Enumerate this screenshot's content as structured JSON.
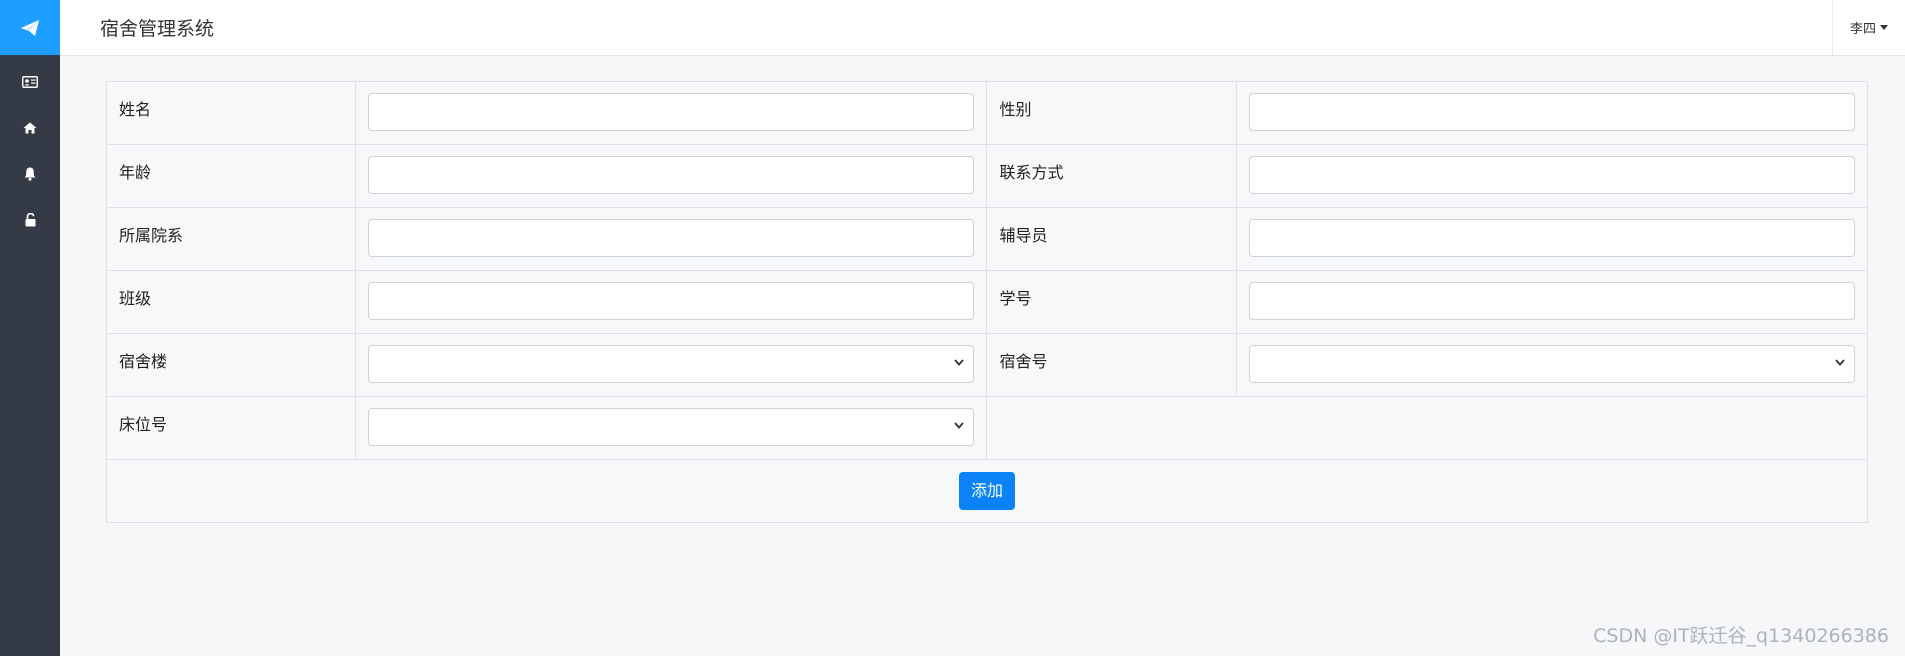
{
  "app": {
    "title": "宿舍管理系统",
    "user_name": "李四"
  },
  "sidebar": {
    "logo_icon": "paper-plane-icon",
    "items": [
      {
        "icon": "id-card-icon"
      },
      {
        "icon": "home-icon"
      },
      {
        "icon": "bell-icon"
      },
      {
        "icon": "unlock-icon"
      }
    ]
  },
  "form": {
    "name_label": "姓名",
    "gender_label": "性别",
    "age_label": "年龄",
    "contact_label": "联系方式",
    "department_label": "所属院系",
    "counselor_label": "辅导员",
    "class_label": "班级",
    "student_id_label": "学号",
    "building_label": "宿舍楼",
    "room_label": "宿舍号",
    "bed_label": "床位号",
    "name_value": "",
    "gender_value": "",
    "age_value": "",
    "contact_value": "",
    "department_value": "",
    "counselor_value": "",
    "class_value": "",
    "student_id_value": "",
    "building_value": "",
    "room_value": "",
    "bed_value": "",
    "submit_label": "添加"
  },
  "watermark": "CSDN @IT跃迁谷_q1340266386",
  "colors": {
    "sidebar_bg": "#343a46",
    "logo_bg": "#1e9fff",
    "primary_button": "#0b82f5"
  }
}
